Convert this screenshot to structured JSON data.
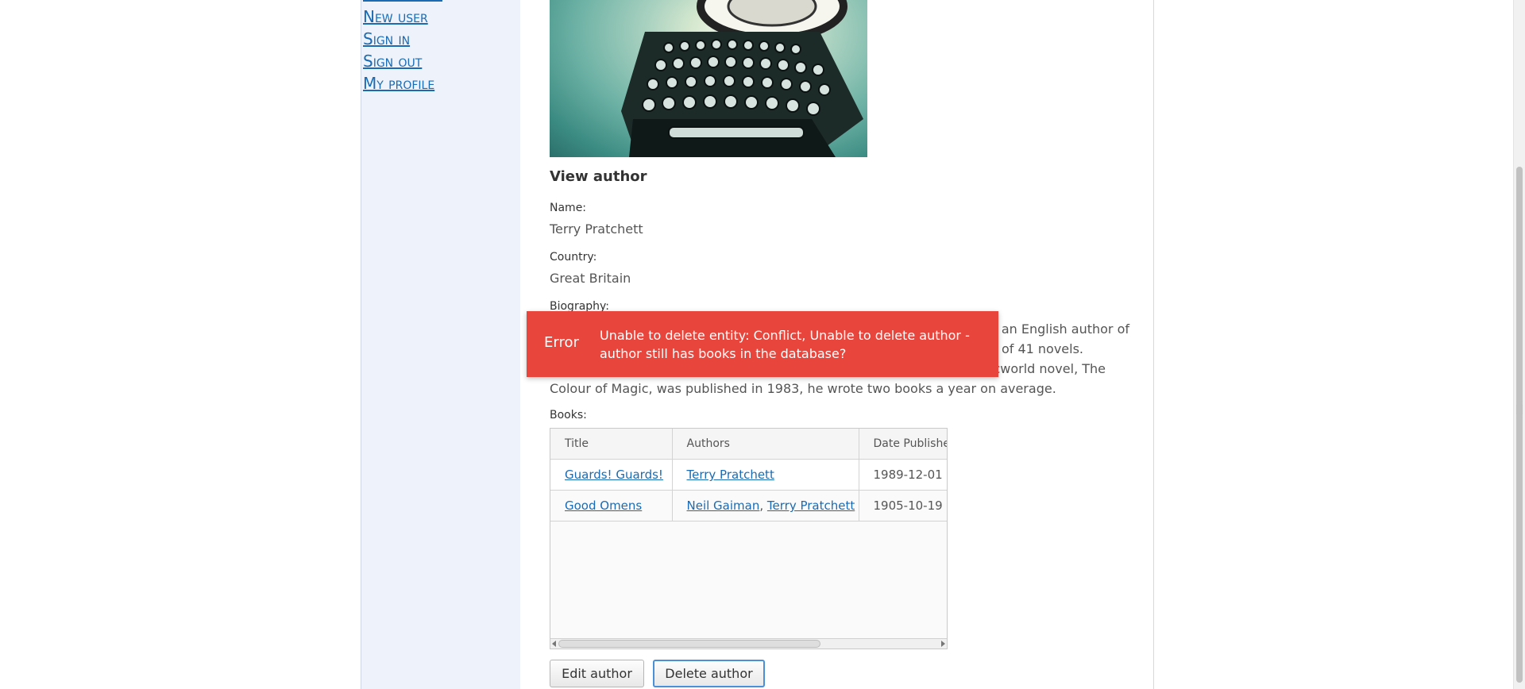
{
  "sidebar": {
    "links": [
      "New user",
      "Sign in",
      "Sign out",
      "My profile"
    ]
  },
  "author_view": {
    "heading": "View author",
    "name_label": "Name:",
    "name_value": "Terry Pratchett",
    "country_label": "Country:",
    "country_value": "Great Britain",
    "biography_label": "Biography:",
    "biography_lines": [
      "as an English author of",
      "es of 41 novels.",
      "iscworld novel, The",
      "Colour of Magic, was published in 1983, he wrote two books a year on average."
    ],
    "books_label": "Books:"
  },
  "error_toast": {
    "title": "Error",
    "message": "Unable to delete entity: Conflict, Unable to delete author - author still has books in the database?"
  },
  "books_table": {
    "columns": [
      "Title",
      "Authors",
      "Date Published"
    ],
    "rows": [
      {
        "title": "Guards! Guards!",
        "authors": [
          "Terry Pratchett"
        ],
        "date": "1989-12-01"
      },
      {
        "title": "Good Omens",
        "authors": [
          "Neil Gaiman",
          "Terry Pratchett"
        ],
        "date": "1905-10-19"
      }
    ]
  },
  "buttons": {
    "edit": "Edit author",
    "delete": "Delete author"
  },
  "colors": {
    "link": "#1a6bb4",
    "error": "#e8453c",
    "sidebar_bg": "#eef2fa"
  }
}
